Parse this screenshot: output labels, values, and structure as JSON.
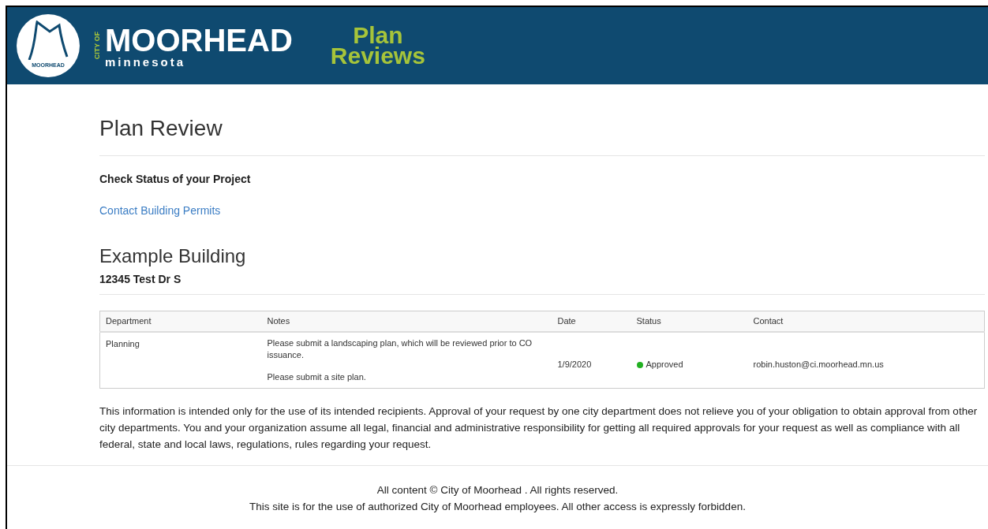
{
  "header": {
    "logo_text": "MOORHEAD",
    "city_of": "CITY OF",
    "city": "MOORHEAD",
    "state": "minnesota",
    "app_title": [
      "Plan",
      "Reviews"
    ]
  },
  "page_title": "Plan Review",
  "subtitle": "Check Status of your Project",
  "contact_link": "Contact Building Permits",
  "project": {
    "name": "Example Building",
    "address": "12345 Test Dr S"
  },
  "table": {
    "columns": [
      "Department",
      "Notes",
      "Date",
      "Status",
      "Contact"
    ],
    "rows": [
      {
        "department": "Planning",
        "notes": [
          "Please submit a landscaping plan, which will be reviewed prior to CO issuance.",
          "Please submit a site plan."
        ],
        "date": "1/9/2020",
        "status": "Approved",
        "color": "#22b022",
        "contact": "robin.huston@ci.moorhead.mn.us"
      }
    ]
  },
  "disclaimer": "This information is intended only for the use of its intended recipients. Approval of your request by one city department does not relieve you of your obligation to obtain approval from other city departments. You and your organization assume all legal, financial and administrative responsibility for getting all required approvals for your request as well as compliance with all federal, state and local laws, regulations, rules regarding your request.",
  "footer": [
    "All content © City of Moorhead . All rights reserved.",
    "This site is for the use of authorized City of Moorhead employees. All other access is expressly forbidden."
  ]
}
